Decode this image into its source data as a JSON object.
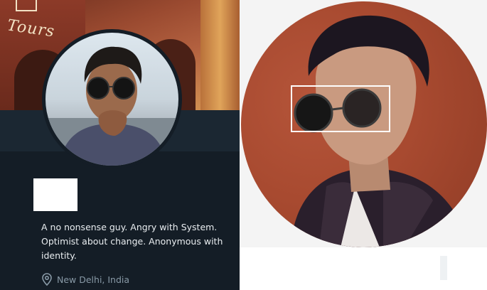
{
  "cover": {
    "sign_text": "Tours"
  },
  "profile": {
    "bio": "A no nonsense guy. Angry with System. Optimist about change. Anonymous with identity.",
    "location": "New Delhi, India"
  },
  "icons": {
    "location": "map-pin-icon"
  },
  "colors": {
    "panel_bg": "#141d26",
    "band_bg": "#1b2732",
    "bio_text": "#e9edf0",
    "muted_text": "#8899a6",
    "right_bg": "#f4f4f4"
  }
}
